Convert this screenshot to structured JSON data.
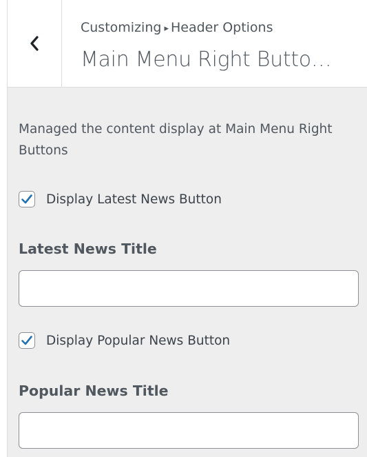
{
  "header": {
    "breadcrumb_parent": "Customizing",
    "breadcrumb_separator": "▸",
    "breadcrumb_current": "Header Options",
    "section_title": "Main Menu Right Butto…",
    "back_icon": "chevron-left-icon"
  },
  "description": "Managed the content display at Main Menu Right Buttons",
  "controls": {
    "latest_news_checkbox": {
      "label": "Display Latest News Button",
      "checked": true
    },
    "latest_news_title": {
      "label": "Latest News Title",
      "value": "",
      "placeholder": ""
    },
    "popular_news_checkbox": {
      "label": "Display Popular News Button",
      "checked": true
    },
    "popular_news_title": {
      "label": "Popular News Title",
      "value": "",
      "placeholder": ""
    }
  },
  "colors": {
    "panel_background": "#eeeeee",
    "checkmark": "#2271b1",
    "border": "#8c8f94"
  }
}
